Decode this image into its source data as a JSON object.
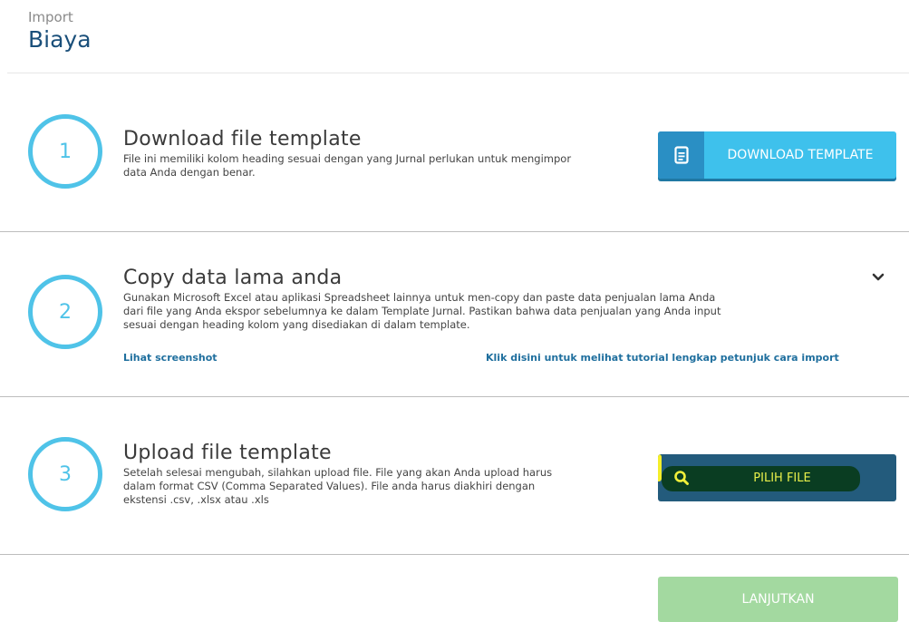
{
  "header": {
    "breadcrumb": "Import",
    "title": "Biaya"
  },
  "steps": [
    {
      "number": "1",
      "title": "Download file template",
      "description_lines": [
        "File ini memiliki kolom heading sesuai dengan yang Jurnal perlukan untuk mengimpor",
        "data Anda dengan benar."
      ],
      "button_label": "DOWNLOAD TEMPLATE",
      "button_icon": "document-icon"
    },
    {
      "number": "2",
      "title": "Copy data lama anda",
      "description_lines": [
        "Gunakan Microsoft Excel atau aplikasi Spreadsheet lainnya untuk men-copy dan paste data penjualan lama Anda",
        "dari file yang Anda ekspor sebelumnya ke dalam Template Jurnal. Pastikan bahwa data penjualan yang Anda input",
        "sesuai dengan heading kolom yang disediakan di dalam template."
      ],
      "link_screenshot": "Lihat screenshot",
      "link_tutorial": "Klik disini untuk melihat tutorial lengkap petunjuk cara import",
      "toggle_icon": "chevron-down-icon"
    },
    {
      "number": "3",
      "title": "Upload file template",
      "description_lines": [
        "Setelah selesai mengubah, silahkan upload file. File yang akan Anda upload harus",
        "dalam format CSV (Comma Separated Values). File anda harus diakhiri dengan",
        "ekstensi .csv, .xlsx atau .xls"
      ],
      "button_label": "PILIH FILE",
      "button_icon": "search-icon"
    }
  ],
  "footer": {
    "continue_label": "LANJUTKAN"
  },
  "colors": {
    "accent": "#4fc3e8",
    "download_button": "#3ec1ec",
    "pilih_button": "#235b7c",
    "continue_button": "#a3d9a0",
    "title": "#1a4f7a"
  }
}
